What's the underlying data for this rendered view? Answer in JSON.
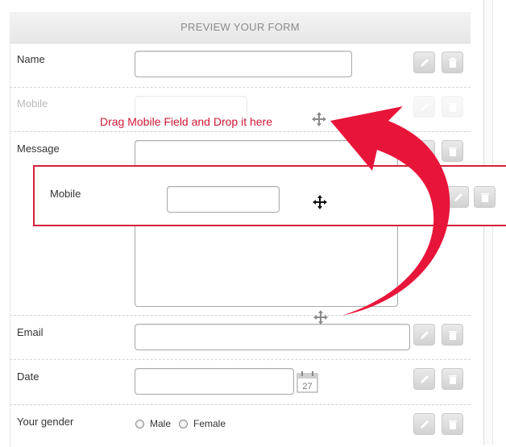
{
  "header": {
    "title": "PREVIEW YOUR FORM"
  },
  "fields": {
    "name": {
      "label": "Name"
    },
    "mobile_ghost": {
      "label": "Mobile"
    },
    "message": {
      "label": "Message"
    },
    "mobile_dragging": {
      "label": "Mobile"
    },
    "email": {
      "label": "Email"
    },
    "date": {
      "label": "Date",
      "calendar_day": "27"
    },
    "gender": {
      "label": "Your gender",
      "options": [
        "Male",
        "Female"
      ]
    }
  },
  "instruction": "Drag Mobile Field and Drop it here",
  "colors": {
    "accent": "#d3203a",
    "arrow": "#e8153a"
  },
  "icons": {
    "edit": "pencil-icon",
    "delete": "trash-icon",
    "move": "move-icon",
    "calendar": "calendar-icon"
  }
}
